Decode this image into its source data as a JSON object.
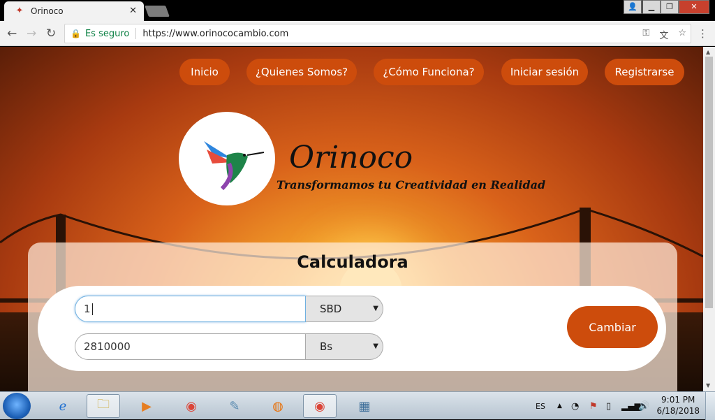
{
  "browser": {
    "tab_title": "Orinoco",
    "secure_label": "Es seguro",
    "url": "https://www.orinococambio.com"
  },
  "site": {
    "nav": [
      "Inicio",
      "¿Quienes Somos?",
      "¿Cómo Funciona?",
      "Iniciar sesión",
      "Registrarse"
    ],
    "brand_name": "Orinoco",
    "tagline": "Transformamos tu Creatividad en Realidad",
    "calculator": {
      "title": "Calculadora",
      "input_amount": "1",
      "from_currency": "SBD",
      "output_amount": "2810000",
      "to_currency": "Bs",
      "button_label": "Cambiar"
    }
  },
  "taskbar": {
    "language": "ES",
    "time": "9:01 PM",
    "date": "6/18/2018"
  },
  "colors": {
    "accent": "#cd4c0c"
  }
}
